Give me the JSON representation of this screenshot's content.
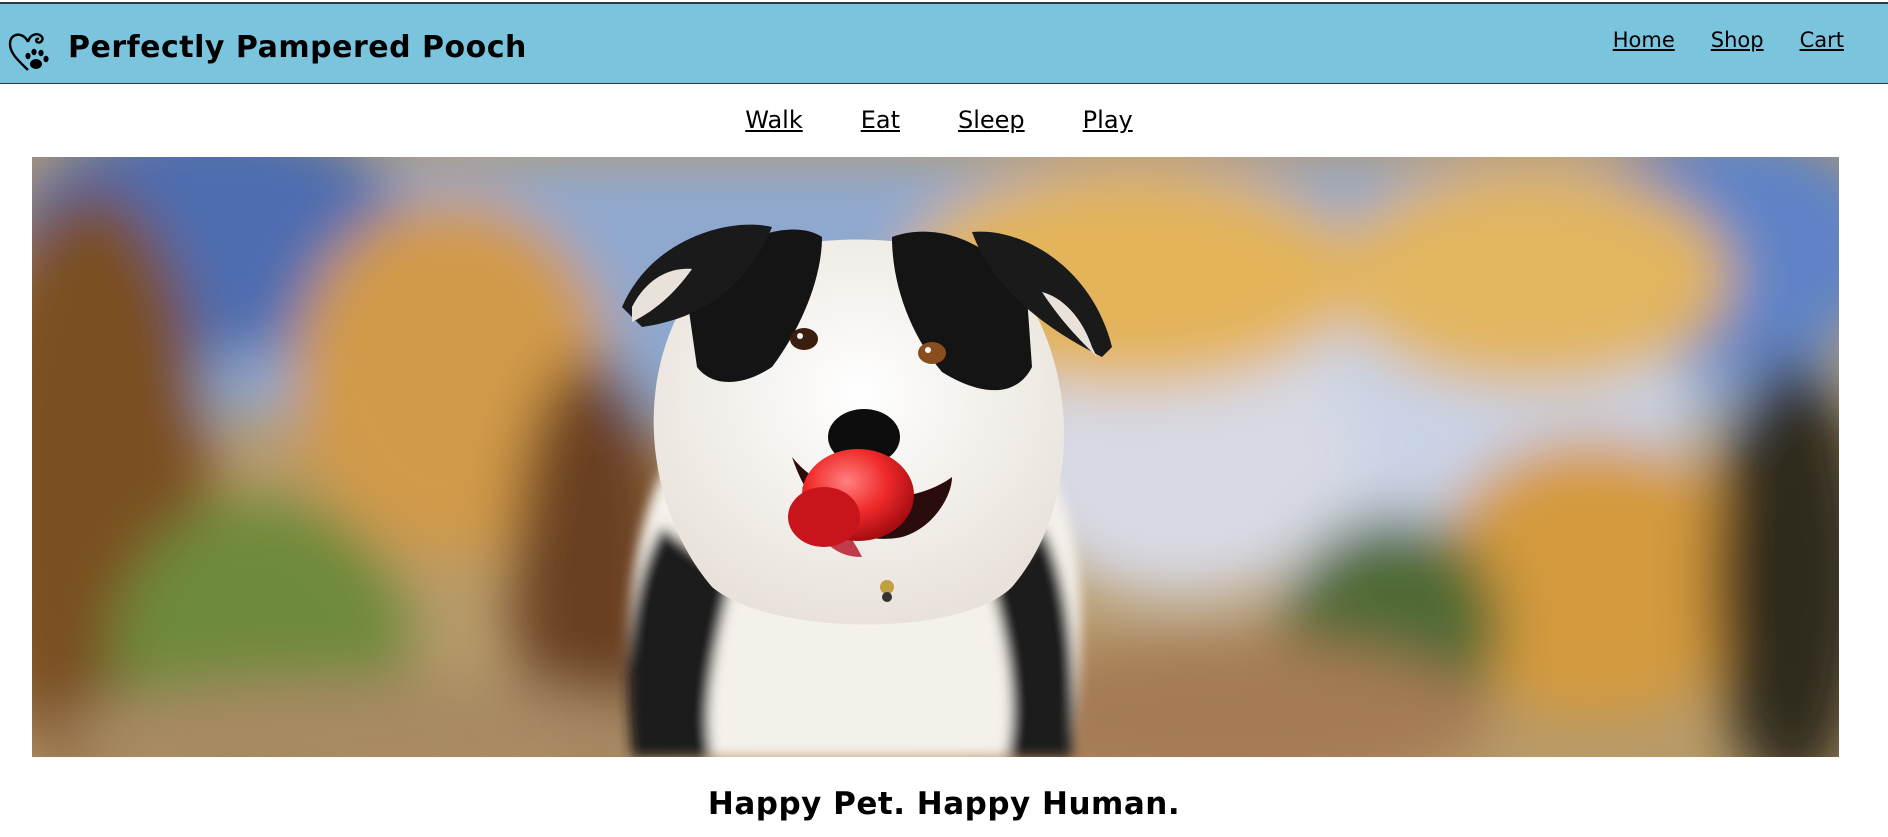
{
  "header": {
    "brand": "Perfectly Pampered Pooch",
    "logo_icon": "heart-paw-icon",
    "nav": [
      {
        "label": "Home"
      },
      {
        "label": "Shop"
      },
      {
        "label": "Cart"
      }
    ],
    "background_color": "#7ac4de"
  },
  "subnav": {
    "items": [
      {
        "label": "Walk"
      },
      {
        "label": "Eat"
      },
      {
        "label": "Sleep"
      },
      {
        "label": "Play"
      }
    ]
  },
  "hero": {
    "image": "border-collie-with-red-ball-photo"
  },
  "tagline": "Happy Pet. Happy Human."
}
